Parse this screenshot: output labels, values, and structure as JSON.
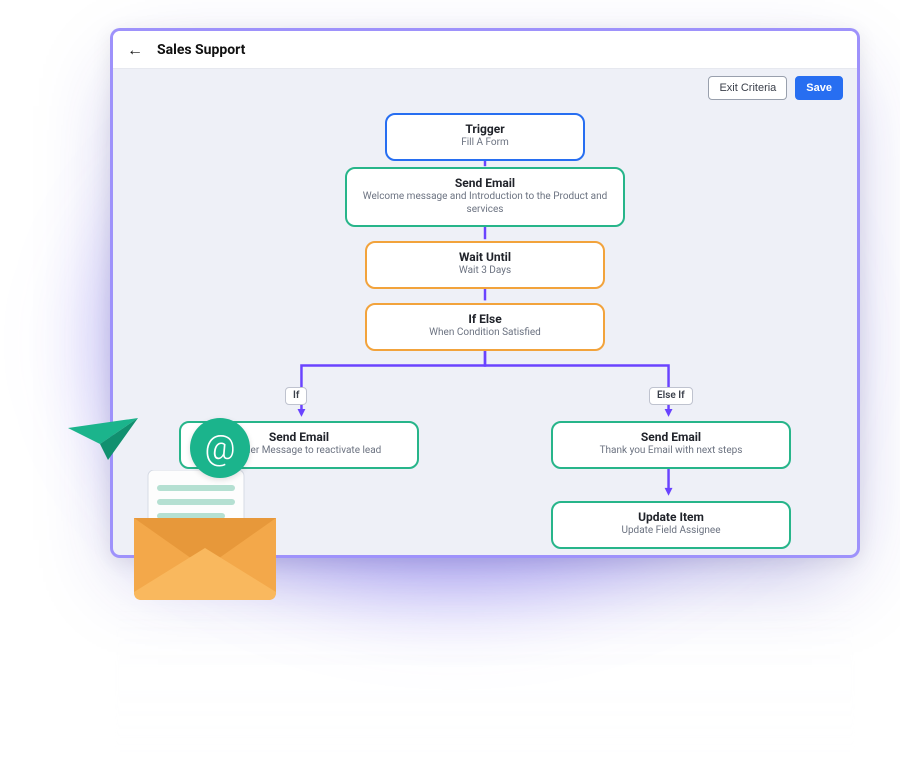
{
  "header": {
    "title": "Sales Support"
  },
  "actions": {
    "exit_label": "Exit Criteria",
    "save_label": "Save"
  },
  "flow": {
    "trigger": {
      "title": "Trigger",
      "subtitle": "Fill A Form"
    },
    "send1": {
      "title": "Send Email",
      "subtitle": "Welcome message and Introduction to the Product and services"
    },
    "wait": {
      "title": "Wait Until",
      "subtitle": "Wait 3 Days"
    },
    "ifelse": {
      "title": "If Else",
      "subtitle": "When Condition Satisfied"
    },
    "chip_if": "If",
    "chip_elseif": "Else If",
    "send_left": {
      "title": "Send Email",
      "subtitle": "Reminder Message to reactivate lead"
    },
    "send_right": {
      "title": "Send Email",
      "subtitle": "Thank you Email with next steps"
    },
    "update": {
      "title": "Update Item",
      "subtitle": "Update Field Assignee"
    }
  },
  "colors": {
    "connector": "#6a43ff",
    "accent_blue": "#276ef1",
    "accent_green": "#27b58a",
    "accent_orange": "#f2a33c"
  }
}
